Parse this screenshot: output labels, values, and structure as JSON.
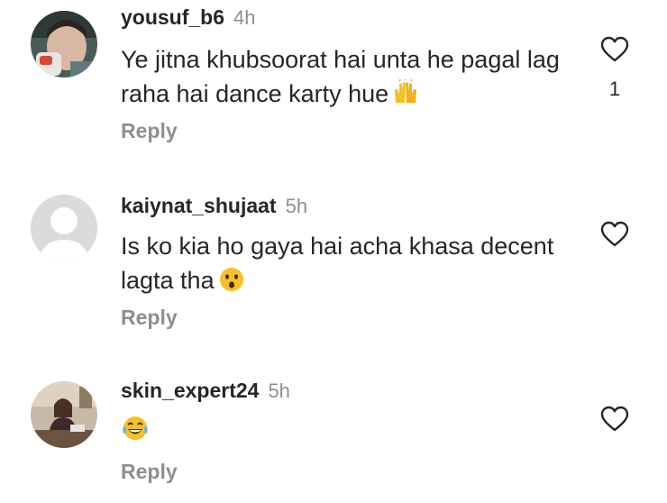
{
  "comments": [
    {
      "username": "yousuf_b6",
      "time": "4h",
      "text": "Ye jitna khubsoorat hai unta he pagal lag raha hai dance karty hue",
      "emoji": "raising-hands-emoji",
      "reply_label": "Reply",
      "likes": "1",
      "avatar": "photo-avatar-child"
    },
    {
      "username": "kaiynat_shujaat",
      "time": "5h",
      "text": "Is ko kia ho gaya hai acha khasa decent lagta tha",
      "emoji": "hushed-face-emoji",
      "reply_label": "Reply",
      "likes": "",
      "avatar": "default-avatar"
    },
    {
      "username": "skin_expert24",
      "time": "5h",
      "text": "",
      "emoji": "tears-of-joy-emoji",
      "reply_label": "Reply",
      "likes": "",
      "avatar": "photo-avatar-office"
    }
  ],
  "colors": {
    "primary_text": "#262626",
    "secondary_text": "#8e8e8e",
    "emoji_yellow": "#f6c026",
    "default_avatar_bg": "#dbdbdb"
  }
}
